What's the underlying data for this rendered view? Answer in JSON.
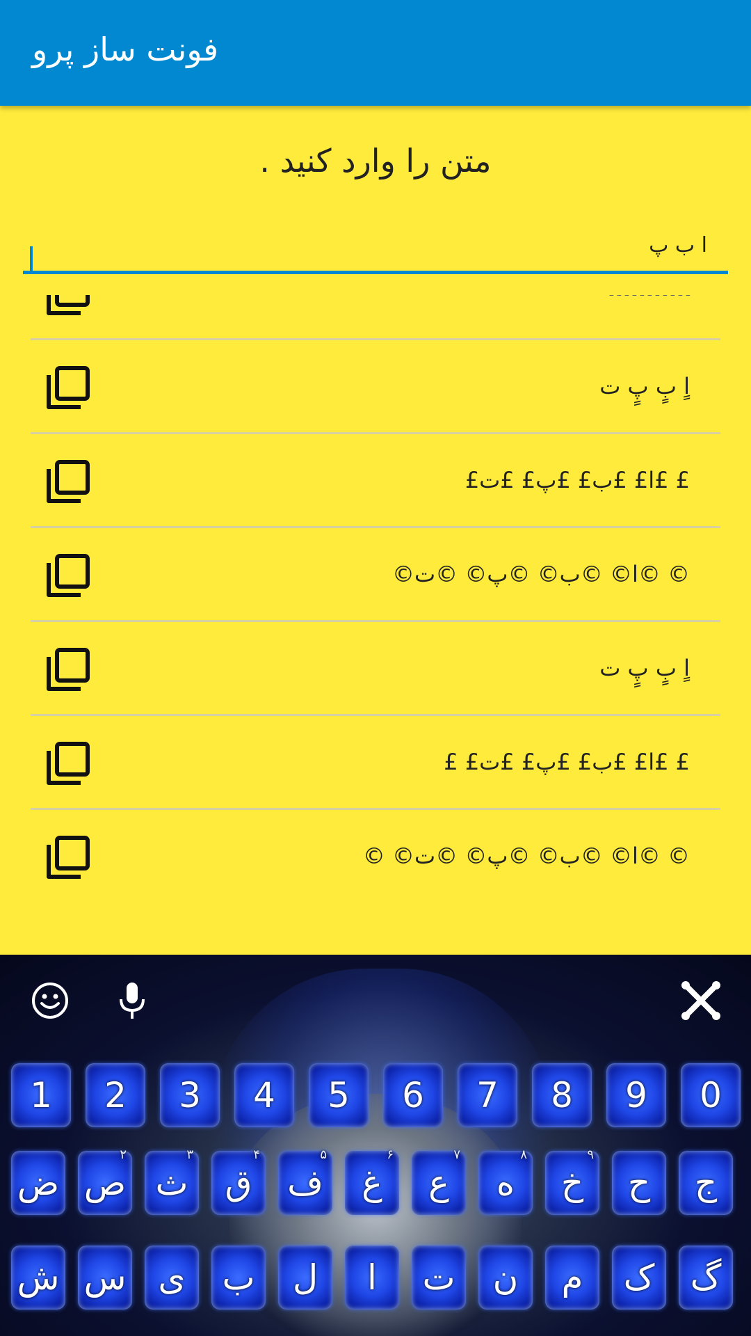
{
  "appbar": {
    "title": "فونت ساز پرو"
  },
  "main": {
    "prompt": "متن را وارد کنید .",
    "input": {
      "value": "ا ب پ",
      "placeholder": ""
    }
  },
  "results": [
    {
      "text": "ـ ـ ـ ـ ـ ـ ـ ـ ـ ـ ـ"
    },
    {
      "text": "اٍ بٍ پٍ ت"
    },
    {
      "text": "£ £ا£ £ب£ £پ£ £ت£"
    },
    {
      "text": "© ©ا© ©ب© ©پ© ©ت©"
    },
    {
      "text": "اٍ بٍ پٍ ت"
    },
    {
      "text": "£ £ا£ £ب£ £پ£ £ت£ £"
    },
    {
      "text": "© ©ا© ©ب© ©پ© ©ت© ©"
    }
  ],
  "keyboard": {
    "toolbar": {
      "emoji_icon": "emoji-icon",
      "mic_icon": "microphone-icon",
      "theme_icon": "crossbones-icon"
    },
    "number_row": [
      "1",
      "2",
      "3",
      "4",
      "5",
      "6",
      "7",
      "8",
      "9",
      "0"
    ],
    "row2": [
      {
        "label": "ض",
        "hint": ""
      },
      {
        "label": "ص",
        "hint": "۲"
      },
      {
        "label": "ث",
        "hint": "۳"
      },
      {
        "label": "ق",
        "hint": "۴"
      },
      {
        "label": "ف",
        "hint": "۵"
      },
      {
        "label": "غ",
        "hint": "۶"
      },
      {
        "label": "ع",
        "hint": "۷"
      },
      {
        "label": "ه",
        "hint": "۸"
      },
      {
        "label": "خ",
        "hint": "۹"
      },
      {
        "label": "ح",
        "hint": ""
      },
      {
        "label": "ج",
        "hint": ""
      }
    ],
    "row3": [
      "ش",
      "س",
      "ی",
      "ب",
      "ل",
      "ا",
      "ت",
      "ن",
      "م",
      "ک",
      "گ"
    ]
  },
  "colors": {
    "appbar": "#0288d1",
    "background": "#ffeb3b",
    "accent": "#0288d1"
  }
}
